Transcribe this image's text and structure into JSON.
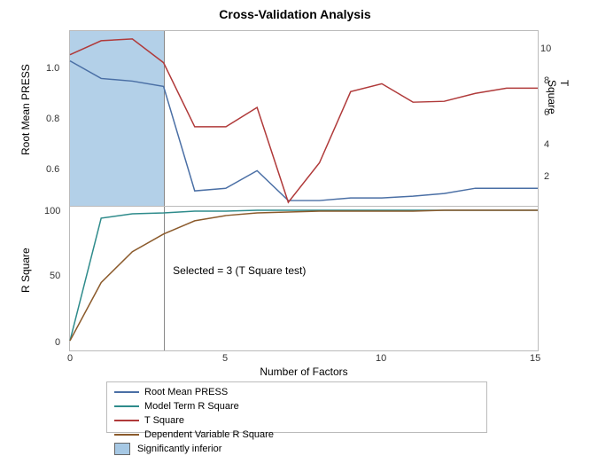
{
  "title": "Cross-Validation Analysis",
  "xlabel": "Number of Factors",
  "ylabel_top_left": "Root Mean PRESS",
  "ylabel_top_right": "T Square",
  "ylabel_bot_left": "R Square",
  "annotation": "Selected = 3 (T Square test)",
  "legend": {
    "rmp": "Root Mean PRESS",
    "mtr": "Model Term R Square",
    "tsq": "T Square",
    "dvr": "Dependent Variable R Square",
    "inf": "Significantly inferior"
  },
  "colors": {
    "rmp": "#4a6fa5",
    "mtr": "#2e8b8b",
    "tsq": "#b03a3a",
    "dvr": "#8b5a2b",
    "shade": "#a6c8e4"
  },
  "x_ticks": [
    0,
    5,
    10,
    15
  ],
  "top_left_ticks": [
    0.6,
    0.8,
    1.0
  ],
  "top_right_ticks": [
    2,
    4,
    6,
    8,
    10
  ],
  "bot_left_ticks": [
    0,
    50,
    100
  ],
  "chart_data": {
    "type": "line",
    "x": [
      0,
      1,
      2,
      3,
      4,
      5,
      6,
      7,
      8,
      9,
      10,
      11,
      12,
      13,
      14,
      15
    ],
    "title": "Cross-Validation Analysis",
    "xlabel": "Number of Factors",
    "panels": [
      {
        "y_left_label": "Root Mean PRESS",
        "y_right_label": "T Square",
        "ylim_left": [
          0.45,
          1.15
        ],
        "ylim_right": [
          0,
          11
        ],
        "series": [
          {
            "name": "Root Mean PRESS",
            "axis": "left",
            "values": [
              1.03,
              0.96,
              0.95,
              0.93,
              0.51,
              0.52,
              0.59,
              0.47,
              0.47,
              0.48,
              0.48,
              0.49,
              0.5,
              0.52,
              0.52,
              0.52
            ]
          },
          {
            "name": "T Square",
            "axis": "right",
            "values": [
              9.5,
              10.4,
              10.5,
              9.0,
              5.0,
              5.0,
              6.2,
              0.2,
              2.7,
              7.2,
              7.7,
              6.5,
              6.6,
              7.1,
              7.4,
              7.4
            ]
          }
        ],
        "shaded_region": {
          "x_from": 0,
          "x_to": 3,
          "label": "Significantly inferior"
        },
        "selected_line_x": 3
      },
      {
        "y_left_label": "R Square",
        "ylim_left": [
          0,
          100
        ],
        "series": [
          {
            "name": "Model Term R Square",
            "axis": "left",
            "values": [
              2,
              94,
              97,
              98,
              99,
              99,
              99.5,
              99.7,
              99.8,
              99.9,
              99.9,
              100,
              100,
              100,
              100,
              100
            ]
          },
          {
            "name": "Dependent Variable R Square",
            "axis": "left",
            "values": [
              2,
              45,
              68,
              81,
              91,
              95,
              97,
              98,
              98.5,
              99,
              99,
              99.3,
              99.5,
              99.7,
              99.8,
              99.9
            ]
          }
        ],
        "annotation": "Selected = 3 (T Square test)",
        "selected_line_x": 3
      }
    ]
  }
}
